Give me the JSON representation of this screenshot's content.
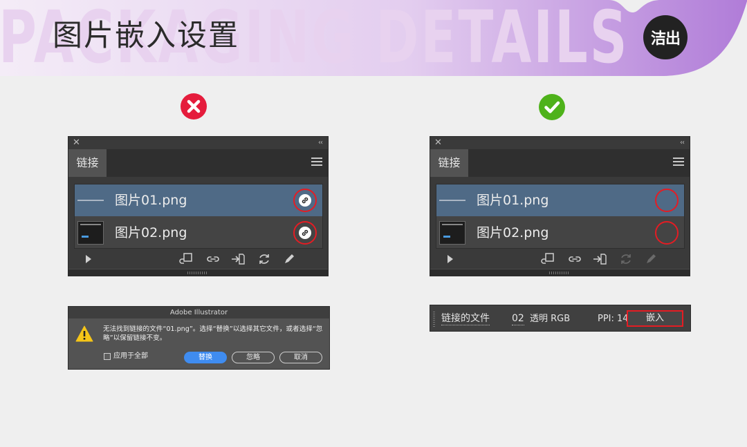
{
  "header": {
    "watermark": "PACKAGING DETAILS",
    "title": "图片嵌入设置",
    "logo_text": "洁出"
  },
  "badges": {
    "wrong_color": "#e51c3c",
    "correct_color": "#4eb21a"
  },
  "panels": [
    {
      "tab_label": "链接",
      "files": [
        "图片01.png",
        "图片02.png"
      ]
    },
    {
      "tab_label": "链接",
      "files": [
        "图片01.png",
        "图片02.png"
      ]
    }
  ],
  "dialog": {
    "title": "Adobe Illustrator",
    "message": "无法找到链接的文件“01.png”。选择“替换”以选择其它文件，或者选择“忽略”以保留链接不变。",
    "checkbox_label": "应用于全部",
    "replace_label": "替换",
    "ignore_label": "忽略",
    "cancel_label": "取消"
  },
  "control_bar": {
    "linked_file_label": "链接的文件",
    "file_number": "02",
    "transparency": "透明 RGB",
    "ppi": "PPI: 144",
    "embed_label": "嵌入"
  },
  "colors": {
    "header_gradient_start": "#f6eef8",
    "header_gradient_end": "#b27fd8",
    "highlight_ring": "#e51c23",
    "panel_bg": "#3a3a3a",
    "selected_row": "#4f6a86",
    "primary_button": "#3f8cf0"
  }
}
